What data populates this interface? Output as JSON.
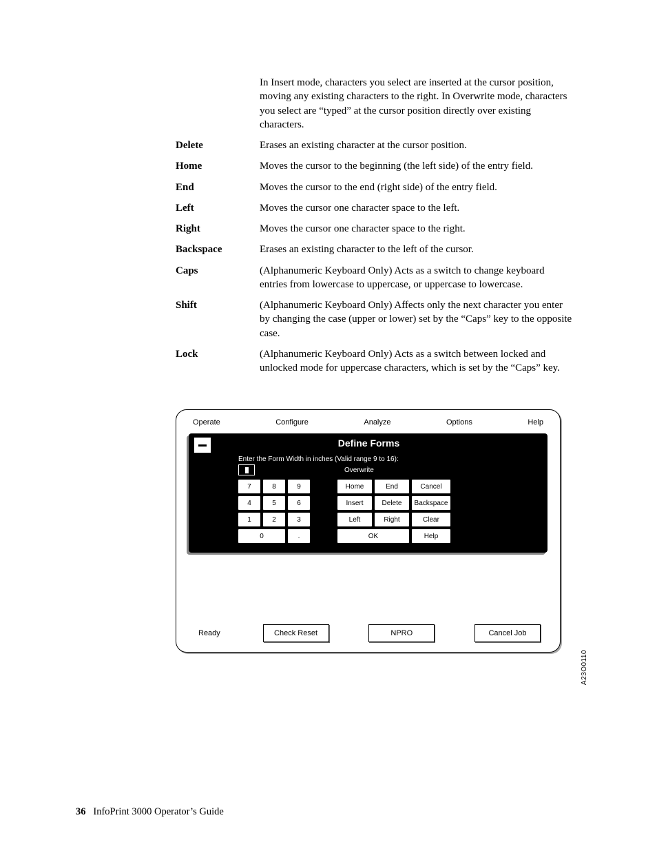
{
  "defs": {
    "intro_desc": "In Insert mode, characters you select are inserted at the cursor position, moving any existing characters to the right. In Overwrite mode, characters you select are “typed” at the cursor position directly over existing characters.",
    "rows": [
      {
        "term": "Delete",
        "desc": "Erases an existing character at the cursor position."
      },
      {
        "term": "Home",
        "desc": "Moves the cursor to the beginning (the left side) of the entry field."
      },
      {
        "term": "End",
        "desc": "Moves the cursor to the end (right side) of the entry field."
      },
      {
        "term": "Left",
        "desc": "Moves the cursor one character space to the left."
      },
      {
        "term": "Right",
        "desc": "Moves the cursor one character space to the right."
      },
      {
        "term": "Backspace",
        "desc": "Erases an existing character to the left of the cursor."
      },
      {
        "term": "Caps",
        "desc": "(Alphanumeric Keyboard Only) Acts as a switch to change keyboard entries from lowercase to uppercase, or uppercase to lowercase."
      },
      {
        "term": "Shift",
        "desc": "(Alphanumeric Keyboard Only) Affects only the next character you enter by changing the case (upper or lower) set by the “Caps” key to the opposite case."
      },
      {
        "term": "Lock",
        "desc": "(Alphanumeric Keyboard Only) Acts as a switch between locked and unlocked mode for uppercase characters, which is set by the “Caps” key."
      }
    ]
  },
  "panel": {
    "menu": {
      "operate": "Operate",
      "configure": "Configure",
      "analyze": "Analyze",
      "options": "Options",
      "help": "Help"
    },
    "dialog_title": "Define Forms",
    "prompt": "Enter the Form Width in inches (Valid range 9 to 16):",
    "mode": "Overwrite",
    "keypad": {
      "r1": [
        "7",
        "8",
        "9"
      ],
      "r2": [
        "4",
        "5",
        "6"
      ],
      "r3": [
        "1",
        "2",
        "3"
      ],
      "r4": [
        "0",
        "."
      ]
    },
    "navpad": {
      "r1": [
        "Home",
        "End",
        "Cancel"
      ],
      "r2": [
        "Insert",
        "Delete",
        "Backspace"
      ],
      "r3": [
        "Left",
        "Right",
        "Clear"
      ],
      "r4": [
        "OK",
        "Help"
      ]
    },
    "bottom": {
      "ready": "Ready",
      "check_reset": "Check Reset",
      "npro": "NPRO",
      "cancel_job": "Cancel Job"
    },
    "figcode": "A23O0110"
  },
  "footer": {
    "page": "36",
    "title": "InfoPrint 3000 Operator’s Guide"
  }
}
